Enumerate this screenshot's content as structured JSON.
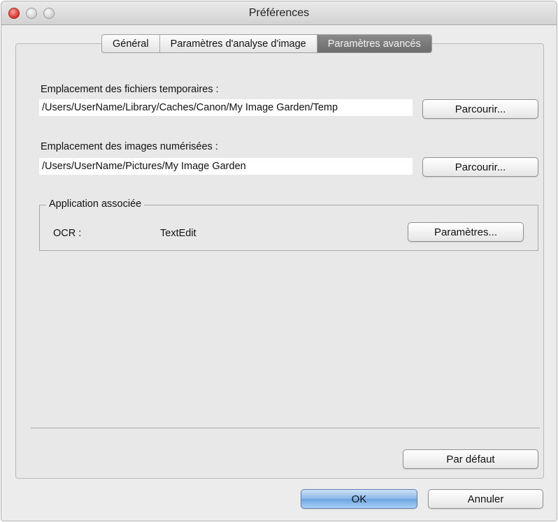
{
  "window": {
    "title": "Préférences"
  },
  "tabs": [
    {
      "label": "Général"
    },
    {
      "label": "Paramètres d'analyse d'image"
    },
    {
      "label": "Paramètres avancés"
    }
  ],
  "temp_files": {
    "label": "Emplacement des fichiers temporaires :",
    "path": "/Users/UserName/Library/Caches/Canon/My Image Garden/Temp",
    "browse_label": "Parcourir..."
  },
  "scanned_images": {
    "label": "Emplacement des images numérisées :",
    "path": "/Users/UserName/Pictures/My Image Garden",
    "browse_label": "Parcourir..."
  },
  "associated_app": {
    "legend": "Application associée",
    "ocr_label": "OCR :",
    "ocr_value": "TextEdit",
    "settings_label": "Paramètres..."
  },
  "footer": {
    "defaults_label": "Par défaut",
    "ok_label": "OK",
    "cancel_label": "Annuler"
  }
}
